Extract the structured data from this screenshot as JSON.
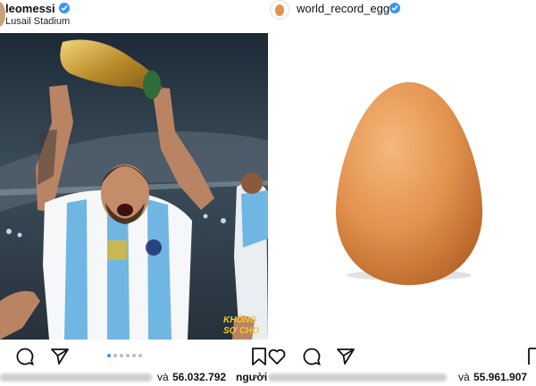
{
  "left_post": {
    "username": "leomessi",
    "location": "Lusail Stadium",
    "overlay_text_1": "KHÔNG",
    "overlay_text_2": "SỢ CHO",
    "likes_prefix": "và",
    "likes_count": "56.032.792",
    "likes_suffix": "người"
  },
  "right_post": {
    "username": "world_record_egg",
    "likes_prefix": "và",
    "likes_count": "55.961.907"
  },
  "colors": {
    "verified": "#3897f0",
    "egg": "#e2934e",
    "jersey_stripe": "#6fb6e3"
  },
  "icons": [
    "verified-badge-icon",
    "comment-icon",
    "share-icon",
    "bookmark-icon",
    "heart-icon",
    "more-icon"
  ]
}
